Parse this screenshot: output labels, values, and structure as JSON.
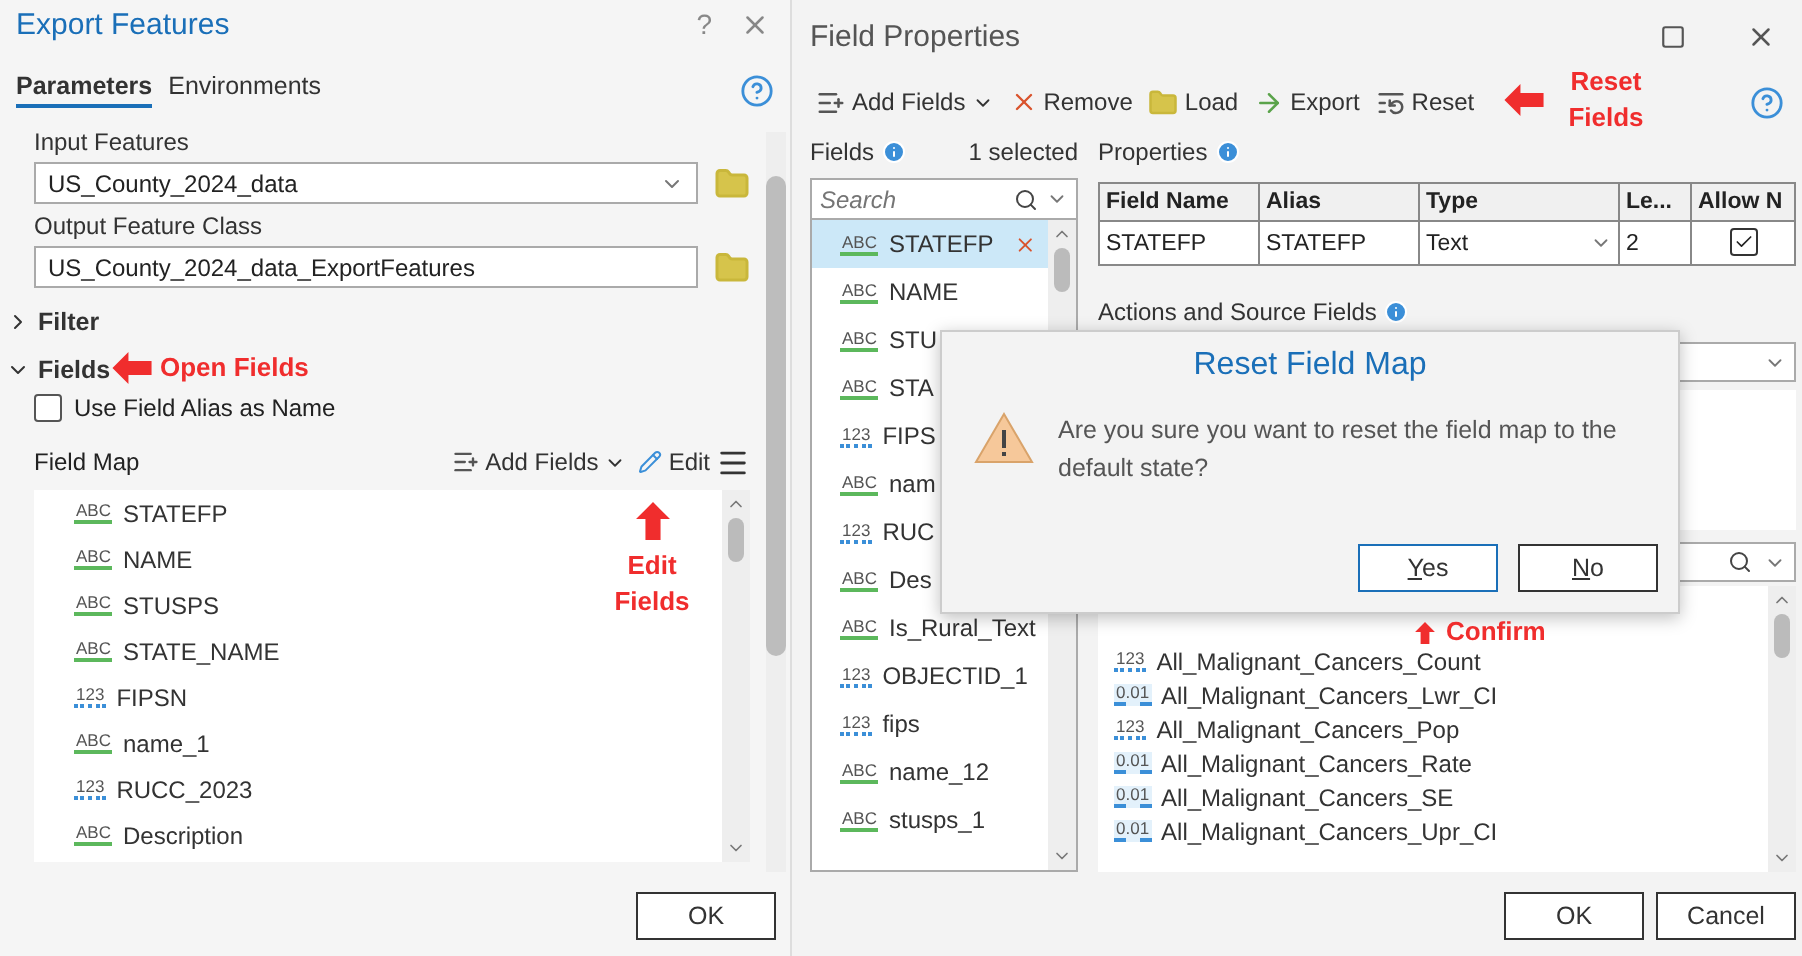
{
  "export_features": {
    "title": "Export Features",
    "help": "?",
    "tabs": [
      {
        "label": "Parameters",
        "selected": true
      },
      {
        "label": "Environments",
        "selected": false
      }
    ],
    "input_features": {
      "label": "Input Features",
      "value": "US_County_2024_data"
    },
    "output_feature_class": {
      "label": "Output Feature Class",
      "value": "US_County_2024_data_ExportFeatures"
    },
    "sections": [
      {
        "label": "Filter",
        "expanded": false
      },
      {
        "label": "Fields",
        "expanded": true
      }
    ],
    "use_alias": {
      "label": "Use Field Alias as Name",
      "checked": false
    },
    "field_map": {
      "label": "Field Map",
      "add_fields": "Add Fields",
      "edit": "Edit",
      "fields": [
        {
          "name": "STATEFP",
          "kind": "text",
          "type_icon": "ABC"
        },
        {
          "name": "NAME",
          "kind": "text",
          "type_icon": "ABC"
        },
        {
          "name": "STUSPS",
          "kind": "text",
          "type_icon": "ABC"
        },
        {
          "name": "STATE_NAME",
          "kind": "text",
          "type_icon": "ABC"
        },
        {
          "name": "FIPSN",
          "kind": "integer",
          "type_icon": "123"
        },
        {
          "name": "name_1",
          "kind": "text",
          "type_icon": "ABC"
        },
        {
          "name": "RUCC_2023",
          "kind": "integer",
          "type_icon": "123"
        },
        {
          "name": "Description",
          "kind": "text",
          "type_icon": "ABC"
        }
      ]
    },
    "ok": "OK"
  },
  "field_properties": {
    "title": "Field Properties",
    "toolbar": [
      {
        "label": "Add Fields",
        "kind": "add"
      },
      {
        "label": "Remove",
        "kind": "remove"
      },
      {
        "label": "Load",
        "kind": "load"
      },
      {
        "label": "Export",
        "kind": "export"
      },
      {
        "label": "Reset",
        "kind": "reset"
      }
    ],
    "fields_heading": "Fields",
    "selected_count": "1 selected",
    "search_placeholder": "Search",
    "fields": [
      {
        "name": "STATEFP",
        "kind": "text",
        "type_icon": "ABC",
        "selected": true
      },
      {
        "name": "NAME",
        "kind": "text",
        "type_icon": "ABC",
        "selected": false
      },
      {
        "name": "STU",
        "kind": "text",
        "type_icon": "ABC",
        "selected": false
      },
      {
        "name": "STA",
        "kind": "text",
        "type_icon": "ABC",
        "selected": false
      },
      {
        "name": "FIPS",
        "kind": "integer",
        "type_icon": "123",
        "selected": false
      },
      {
        "name": "nam",
        "kind": "text",
        "type_icon": "ABC",
        "selected": false
      },
      {
        "name": "RUC",
        "kind": "integer",
        "type_icon": "123",
        "selected": false
      },
      {
        "name": "Des",
        "kind": "text",
        "type_icon": "ABC",
        "selected": false
      },
      {
        "name": "Is_Rural_Text",
        "kind": "text",
        "type_icon": "ABC",
        "selected": false
      },
      {
        "name": "OBJECTID_1",
        "kind": "integer",
        "type_icon": "123",
        "selected": false
      },
      {
        "name": "fips",
        "kind": "integer",
        "type_icon": "123",
        "selected": false
      },
      {
        "name": "name_12",
        "kind": "text",
        "type_icon": "ABC",
        "selected": false
      },
      {
        "name": "stusps_1",
        "kind": "text",
        "type_icon": "ABC",
        "selected": false
      }
    ],
    "properties_heading": "Properties",
    "table": {
      "columns": [
        "Field Name",
        "Alias",
        "Type",
        "Le...",
        "Allow N"
      ],
      "row": {
        "field_name": "STATEFP",
        "alias": "STATEFP",
        "type": "Text",
        "length": "2",
        "allow_null": true
      }
    },
    "actions_heading": "Actions and Source Fields",
    "source_fields": [
      {
        "name": "All_Malignant_Cancers_Count",
        "kind": "integer",
        "type_icon": "123"
      },
      {
        "name": "All_Malignant_Cancers_Lwr_CI",
        "kind": "double",
        "type_icon": "0.01"
      },
      {
        "name": "All_Malignant_Cancers_Pop",
        "kind": "integer",
        "type_icon": "123"
      },
      {
        "name": "All_Malignant_Cancers_Rate",
        "kind": "double",
        "type_icon": "0.01"
      },
      {
        "name": "All_Malignant_Cancers_SE",
        "kind": "double",
        "type_icon": "0.01"
      },
      {
        "name": "All_Malignant_Cancers_Upr_CI",
        "kind": "double",
        "type_icon": "0.01"
      }
    ],
    "buttons": [
      "OK",
      "Cancel"
    ]
  },
  "dialog": {
    "title": "Reset Field Map",
    "message": "Are you sure you want to reset the field map to the default state?",
    "buttons": [
      {
        "label": "Yes",
        "selected": true
      },
      {
        "label": "No",
        "selected": false
      }
    ]
  },
  "annotations": [
    {
      "text": "Open Fields",
      "kind": "left"
    },
    {
      "text": "Edit Fields",
      "kind": "up"
    },
    {
      "text": "Reset Fields",
      "kind": "left"
    },
    {
      "text": "Confirm",
      "kind": "up"
    }
  ]
}
